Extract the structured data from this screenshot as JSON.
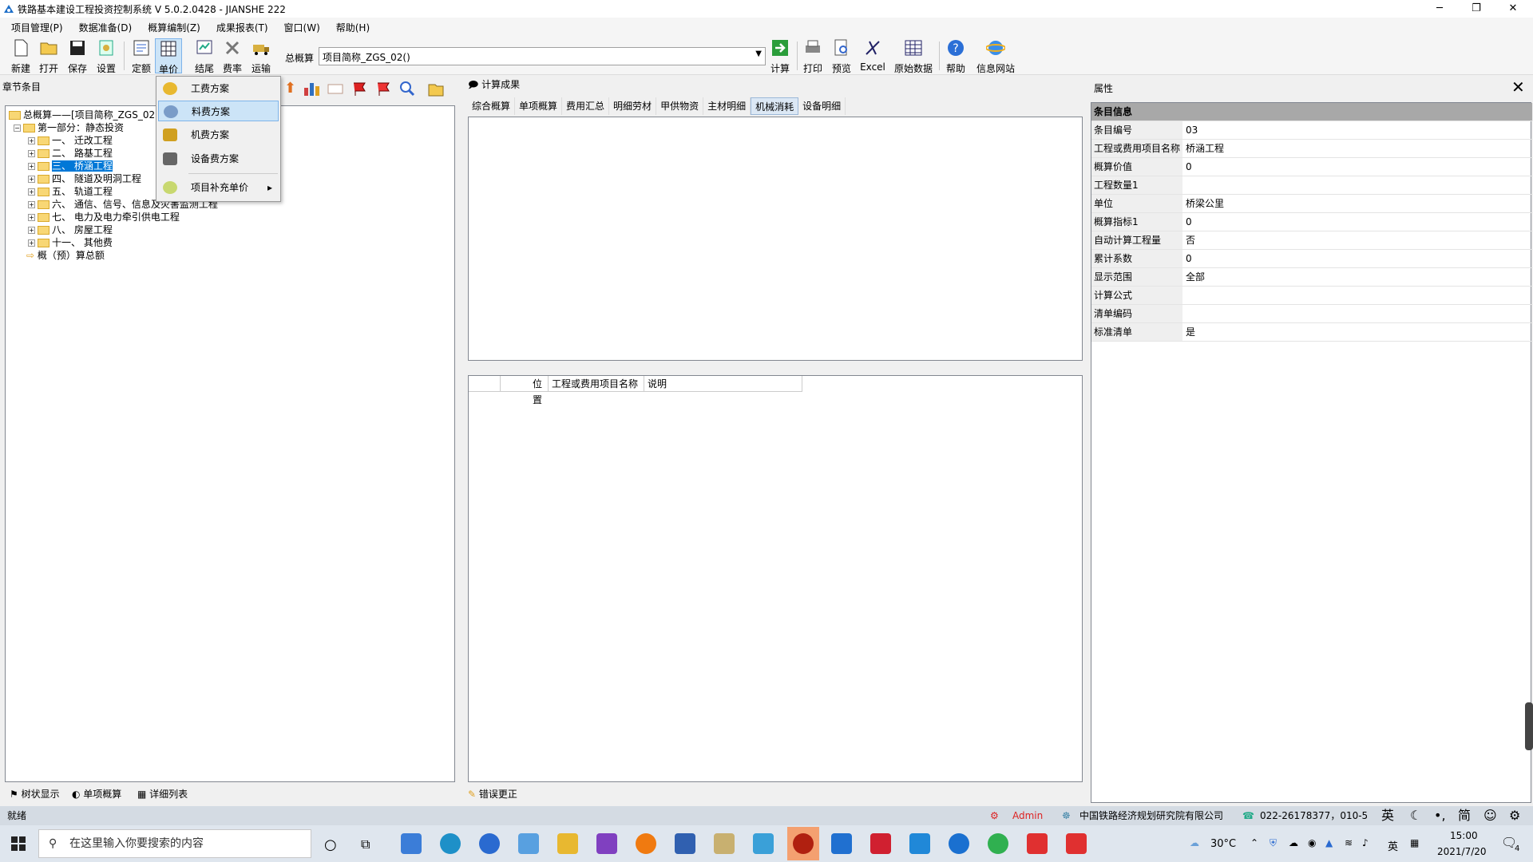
{
  "window": {
    "title": "铁路基本建设工程投资控制系统 V 5.0.2.0428 - JIANSHE 222",
    "min": "─",
    "max": "❐",
    "close": "✕"
  },
  "menu": [
    "项目管理(P)",
    "数据准备(D)",
    "概算编制(Z)",
    "成果报表(T)",
    "窗口(W)",
    "帮助(H)"
  ],
  "toolbar": {
    "buttons": [
      "新建",
      "打开",
      "保存",
      "设置",
      "定额",
      "单价",
      "结尾",
      "费率",
      "运输",
      "计算",
      "打印",
      "预览",
      "Excel",
      "原始数据",
      "帮助",
      "信息网站"
    ],
    "combo_label": "总概算",
    "combo_value": "项目简称_ZGS_02()"
  },
  "dropdown": {
    "items": [
      "工费方案",
      "料费方案",
      "机费方案",
      "设备费方案",
      "项目补充单价"
    ],
    "highlighted": "料费方案"
  },
  "left_panel": {
    "title": "章节条目",
    "tree": [
      {
        "label": "总概算——[项目简称_ZGS_02()]",
        "level": 0
      },
      {
        "label": "第一部分：静态投资",
        "level": 1
      },
      {
        "label": "一、  迁改工程",
        "level": 2
      },
      {
        "label": "二、  路基工程",
        "level": 2
      },
      {
        "label": "三、  桥涵工程",
        "level": 2,
        "selected": true
      },
      {
        "label": "四、  隧道及明洞工程",
        "level": 2
      },
      {
        "label": "五、  轨道工程",
        "level": 2
      },
      {
        "label": "六、  通信、信号、信息及灾害监测工程",
        "level": 2
      },
      {
        "label": "七、  电力及电力牵引供电工程",
        "level": 2
      },
      {
        "label": "八、  房屋工程",
        "level": 2
      },
      {
        "label": "十一、  其他费",
        "level": 2
      },
      {
        "label": "概（预）算总额",
        "level": 1
      }
    ],
    "tabs": [
      "树状显示",
      "单项概算",
      "详细列表"
    ]
  },
  "mid_panel": {
    "title": "计算成果",
    "tabs": [
      "综合概算",
      "单项概算",
      "费用汇总",
      "明细劳材",
      "甲供物资",
      "主材明细",
      "机械消耗",
      "设备明细"
    ],
    "active_tab": "机械消耗",
    "grid_headers": [
      "",
      "位置",
      "工程或费用项目名称",
      "说明"
    ],
    "bottom_tab": "错误更正"
  },
  "right_panel": {
    "title": "属性",
    "close": "✕",
    "section": "条目信息",
    "rows": [
      {
        "k": "条目编号",
        "v": "03"
      },
      {
        "k": "工程或费用项目名称",
        "v": "桥涵工程"
      },
      {
        "k": "概算价值",
        "v": "0"
      },
      {
        "k": "工程数量1",
        "v": ""
      },
      {
        "k": "单位",
        "v": "桥梁公里"
      },
      {
        "k": "概算指标1",
        "v": "0"
      },
      {
        "k": "自动计算工程量",
        "v": "否"
      },
      {
        "k": "累计系数",
        "v": "0"
      },
      {
        "k": "显示范围",
        "v": "全部"
      },
      {
        "k": "计算公式",
        "v": ""
      },
      {
        "k": "清单编码",
        "v": ""
      },
      {
        "k": "标准清单",
        "v": "是"
      }
    ]
  },
  "status": {
    "left": "就绪",
    "user": "Admin",
    "company": "中国铁路经济规划研究院有限公司",
    "phone": "022-26178377，010-5",
    "ime": "英",
    "simp": "简"
  },
  "taskbar": {
    "search_placeholder": "在这里输入你要搜索的内容",
    "temp": "30°C",
    "lang": "英",
    "time": "15:00",
    "date": "2021/7/20",
    "notif": "4"
  }
}
